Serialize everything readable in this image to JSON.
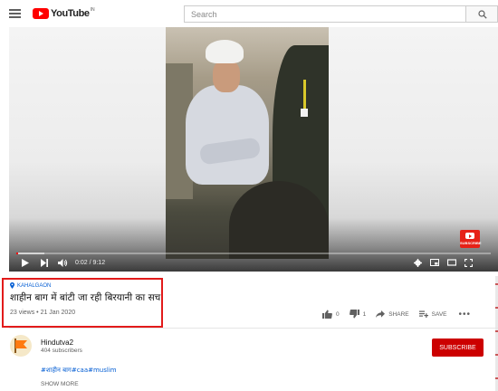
{
  "header": {
    "logo_text": "YouTube",
    "logo_sup": "IN",
    "search_placeholder": "Search"
  },
  "player": {
    "time_current": "0:02",
    "time_total": "9:12",
    "time_display": "0:02 / 9:12",
    "progress_fraction": 0.004,
    "loaded_fraction": 0.06,
    "watermark_text": "SUBSCRIBE"
  },
  "video": {
    "location": "KAHALGAON",
    "title": "शाहीन बाग में बांटी जा रही बिरयानी का सच",
    "meta": "23 views • 21 Jan 2020"
  },
  "actions": {
    "likes": "0",
    "dislikes": "1",
    "share_label": "SHARE",
    "save_label": "SAVE",
    "more_label": "•••"
  },
  "channel": {
    "name": "Hindutva2",
    "subscribers": "404 subscribers",
    "subscribe_label": "SUBSCRIBE"
  },
  "description": {
    "tags": "#शाहीन बाग#caa#muslim",
    "show_more": "SHOW MORE"
  },
  "colors": {
    "brand_red": "#ff0000",
    "subscribe_red": "#cc0000",
    "link_blue": "#065fd4",
    "highlight_red": "#e21b1b"
  }
}
